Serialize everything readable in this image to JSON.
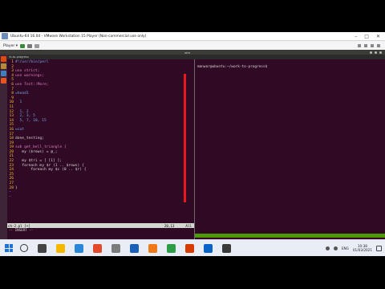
{
  "window": {
    "title": "Ubuntu-64 16.04 - VMware Workstation 15 Player (Non-commercial use only)",
    "player_menu": "Player ▾"
  },
  "guest": {
    "top_bar_title": "vim",
    "terminal_tab": "rk-to-progress"
  },
  "editor": {
    "lines": [
      {
        "n": "1",
        "text": "#!/usr/bin/perl",
        "kind": "cmt"
      },
      {
        "n": "2",
        "text": "",
        "kind": "code"
      },
      {
        "n": "3",
        "text": "use strict;",
        "kind": "kw"
      },
      {
        "n": "4",
        "text": "use warnings;",
        "kind": "kw"
      },
      {
        "n": "5",
        "text": "",
        "kind": "code"
      },
      {
        "n": "6",
        "text": "use Test::More;",
        "kind": "kw"
      },
      {
        "n": "7",
        "text": "",
        "kind": "code"
      },
      {
        "n": "8",
        "text": "=head1",
        "kind": "cmt"
      },
      {
        "n": "9",
        "text": "",
        "kind": "code"
      },
      {
        "n": "10",
        "text": "  1",
        "kind": "cmt"
      },
      {
        "n": "11",
        "text": "",
        "kind": "code"
      },
      {
        "n": "12",
        "text": "  1, 2",
        "kind": "cmt"
      },
      {
        "n": "13",
        "text": "  2, 3, 5",
        "kind": "cmt"
      },
      {
        "n": "14",
        "text": "  5, 7, 10, 15",
        "kind": "cmt"
      },
      {
        "n": "15",
        "text": "",
        "kind": "code"
      },
      {
        "n": "16",
        "text": "=cut",
        "kind": "cmt"
      },
      {
        "n": "17",
        "text": "",
        "kind": "code"
      },
      {
        "n": "18",
        "text": "done_testing;",
        "kind": "code"
      },
      {
        "n": "19",
        "text": "",
        "kind": "code"
      },
      {
        "n": "19",
        "text": "sub get_bell_triangle {",
        "kind": "kw"
      },
      {
        "n": "20",
        "text": "   my ($rows) = @_;",
        "kind": "code"
      },
      {
        "n": "21",
        "text": "",
        "kind": "code"
      },
      {
        "n": "22",
        "text": "   my $tri = [ [1] ];",
        "kind": "code"
      },
      {
        "n": "23",
        "text": "   foreach my $r (1 .. $rows) {",
        "kind": "code"
      },
      {
        "n": "24",
        "text": "       foreach my $c (0 .. $r) {",
        "kind": "code"
      },
      {
        "n": "25",
        "text": "",
        "kind": "code"
      },
      {
        "n": "26",
        "text": "",
        "kind": "code"
      },
      {
        "n": "27",
        "text": "",
        "kind": "code"
      },
      {
        "n": "28",
        "text": "}",
        "kind": "code"
      }
    ],
    "tildes": [
      "~",
      "~"
    ],
    "status_file": "ch-2.pl [+]",
    "status_pos": "20,13",
    "status_pct": "All",
    "mode": "-- INSERT --"
  },
  "terminal": {
    "prompt": "manwar@ubuntu:~/work-to-progress$"
  },
  "taskbar": {
    "lang": "ENG",
    "time": "10:38",
    "date": "01/03/2021"
  }
}
